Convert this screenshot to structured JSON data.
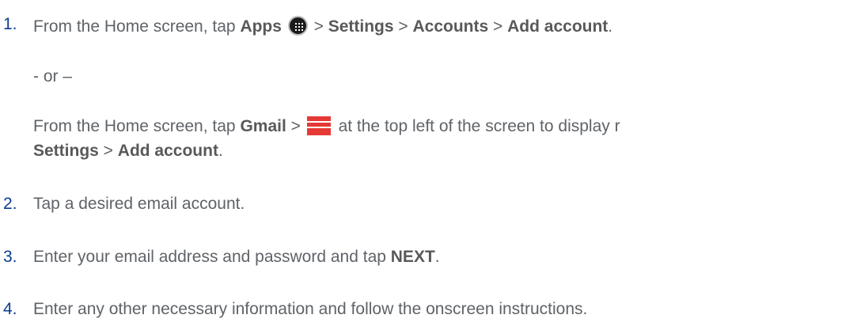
{
  "steps": [
    {
      "number": "1.",
      "main": {
        "prefix": "From the Home screen, tap ",
        "apps": "Apps",
        "sep1": " > ",
        "settings": "Settings",
        "sep2": " > ",
        "accounts": "Accounts",
        "sep3": " > ",
        "add_account": "Add account",
        "end": "."
      },
      "or_text": "- or –",
      "alt": {
        "prefix": "From the Home screen, tap ",
        "gmail": "Gmail",
        "sep": " > ",
        "suffix": " at the top left of the screen to display r",
        "line2_settings": "Settings",
        "line2_sep": " > ",
        "line2_add_account": "Add account",
        "line2_end": "."
      }
    },
    {
      "number": "2.",
      "text": "Tap a desired email account."
    },
    {
      "number": "3.",
      "text_before": "Enter your email address and password and tap ",
      "bold": "NEXT",
      "text_after": "."
    },
    {
      "number": "4.",
      "text": "Enter any other necessary information and follow the onscreen instructions."
    }
  ],
  "icons": {
    "apps": "apps-grid-icon",
    "menu": "menu-hamburger-icon"
  },
  "colors": {
    "text": "#5f6368",
    "number": "#0b3d91",
    "menu_icon": "#e53935",
    "apps_icon": "#1a1a1a"
  }
}
